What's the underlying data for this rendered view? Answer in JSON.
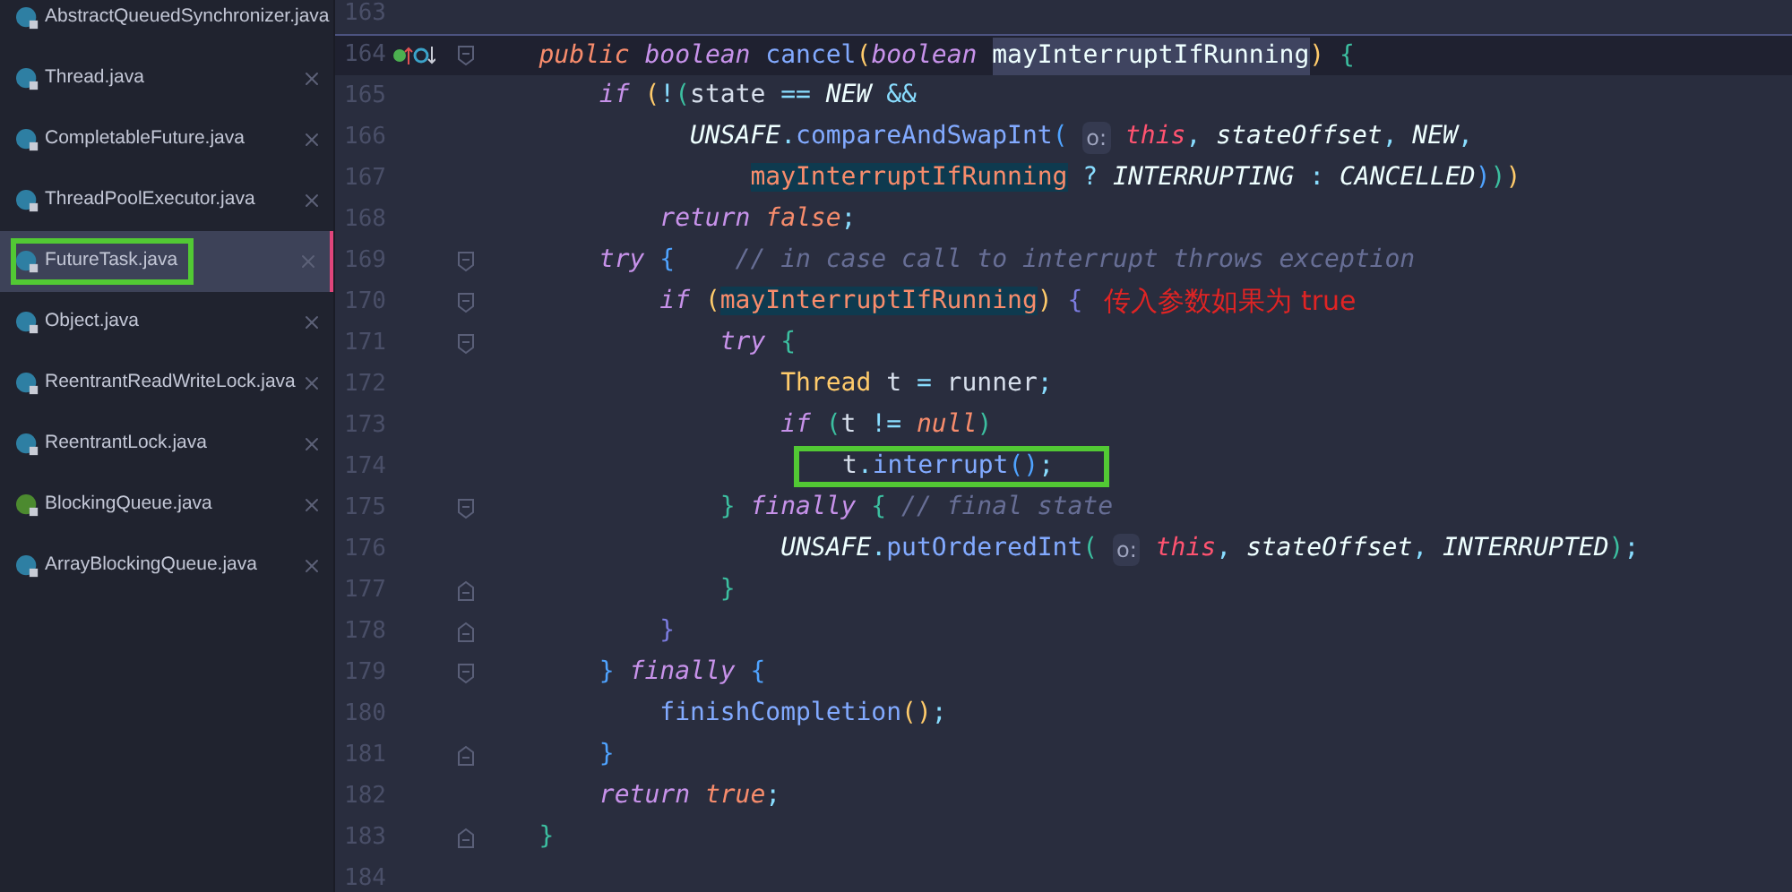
{
  "sidebar": {
    "items": [
      {
        "label": "AbstractQueuedSynchronizer.java",
        "kind": "class",
        "selected": false,
        "boxed": false,
        "closable": false
      },
      {
        "label": "Thread.java",
        "kind": "class",
        "selected": false,
        "boxed": false,
        "closable": true
      },
      {
        "label": "CompletableFuture.java",
        "kind": "class",
        "selected": false,
        "boxed": false,
        "closable": true
      },
      {
        "label": "ThreadPoolExecutor.java",
        "kind": "class",
        "selected": false,
        "boxed": false,
        "closable": true
      },
      {
        "label": "FutureTask.java",
        "kind": "class",
        "selected": true,
        "boxed": true,
        "closable": true
      },
      {
        "label": "Object.java",
        "kind": "class",
        "selected": false,
        "boxed": false,
        "closable": true
      },
      {
        "label": "ReentrantReadWriteLock.java",
        "kind": "class",
        "selected": false,
        "boxed": false,
        "closable": true
      },
      {
        "label": "ReentrantLock.java",
        "kind": "class",
        "selected": false,
        "boxed": false,
        "closable": true
      },
      {
        "label": "BlockingQueue.java",
        "kind": "interface",
        "selected": false,
        "boxed": false,
        "closable": true
      },
      {
        "label": "ArrayBlockingQueue.java",
        "kind": "class",
        "selected": false,
        "boxed": false,
        "closable": true
      }
    ]
  },
  "editor": {
    "lines": [
      {
        "number": "163",
        "kind": "plain",
        "current": false
      },
      {
        "number": "164",
        "kind": "fold_open",
        "current": true,
        "boxed": false,
        "gutter_icons": true,
        "tokens": [
          {
            "kind": "kw2",
            "text": "    public"
          },
          {
            "kind": "kw",
            "text": " boolean"
          },
          {
            "kind": "fn",
            "text": " cancel"
          },
          {
            "kind": "p1",
            "text": "("
          },
          {
            "kind": "kw",
            "text": "boolean "
          },
          {
            "kind": "sel",
            "text": "mayInterruptIfRunning"
          },
          {
            "kind": "p1",
            "text": ")"
          },
          {
            "kind": "p3",
            "text": " {"
          }
        ]
      },
      {
        "number": "165",
        "kind": "plain",
        "current": false,
        "boxed": false,
        "tokens": [
          {
            "kind": "kw",
            "text": "        if"
          },
          {
            "kind": "p1",
            "text": " ("
          },
          {
            "kind": "op",
            "text": "!"
          },
          {
            "kind": "p3",
            "text": "("
          },
          {
            "kind": "plain",
            "text": "state"
          },
          {
            "kind": "op",
            "text": " =="
          },
          {
            "kind": "const",
            "text": " NEW"
          },
          {
            "kind": "op",
            "text": " &&"
          }
        ]
      },
      {
        "number": "166",
        "kind": "plain",
        "current": false,
        "boxed": false,
        "tokens": [
          {
            "kind": "const",
            "text": "              UNSAFE"
          },
          {
            "kind": "op",
            "text": "."
          },
          {
            "kind": "fn",
            "text": "compareAndSwapInt"
          },
          {
            "kind": "p2",
            "text": "( "
          },
          {
            "kind": "hint",
            "text": "o:"
          },
          {
            "kind": "this",
            "text": " this"
          },
          {
            "kind": "op",
            "text": ","
          },
          {
            "kind": "ital",
            "text": " stateOffset"
          },
          {
            "kind": "op",
            "text": ","
          },
          {
            "kind": "const",
            "text": " NEW"
          },
          {
            "kind": "op",
            "text": ","
          }
        ]
      },
      {
        "number": "167",
        "kind": "plain",
        "current": false,
        "boxed": false,
        "tokens": [
          {
            "kind": "hl",
            "text": "                  mayInterruptIfRunning"
          },
          {
            "kind": "op",
            "text": " ?"
          },
          {
            "kind": "const",
            "text": " INTERRUPTING"
          },
          {
            "kind": "op",
            "text": " :"
          },
          {
            "kind": "const",
            "text": " CANCELLED"
          },
          {
            "kind": "p2",
            "text": ")"
          },
          {
            "kind": "p3",
            "text": ")"
          },
          {
            "kind": "p1",
            "text": ")"
          }
        ]
      },
      {
        "number": "168",
        "kind": "plain",
        "current": false,
        "boxed": false,
        "tokens": [
          {
            "kind": "kw",
            "text": "            return"
          },
          {
            "kind": "lit",
            "text": " false"
          },
          {
            "kind": "op",
            "text": ";"
          }
        ]
      },
      {
        "number": "169",
        "kind": "fold_open",
        "current": false,
        "boxed": false,
        "tokens": [
          {
            "kind": "kw",
            "text": "        try"
          },
          {
            "kind": "p2",
            "text": " {"
          },
          {
            "kind": "comment",
            "text": "    // in case call to interrupt throws exception"
          }
        ]
      },
      {
        "number": "170",
        "kind": "fold_open",
        "current": false,
        "boxed": false,
        "annotation": "传入参数如果为 true",
        "tokens": [
          {
            "kind": "kw",
            "text": "            if"
          },
          {
            "kind": "p1",
            "text": " ("
          },
          {
            "kind": "hl",
            "text": "mayInterruptIfRunning"
          },
          {
            "kind": "p1",
            "text": ")"
          },
          {
            "kind": "p4",
            "text": " {"
          }
        ]
      },
      {
        "number": "171",
        "kind": "fold_open",
        "current": false,
        "boxed": false,
        "tokens": [
          {
            "kind": "kw",
            "text": "                try"
          },
          {
            "kind": "p3",
            "text": " {"
          }
        ]
      },
      {
        "number": "172",
        "kind": "plain",
        "current": false,
        "boxed": false,
        "tokens": [
          {
            "kind": "type",
            "text": "                    Thread"
          },
          {
            "kind": "plain",
            "text": " t"
          },
          {
            "kind": "op",
            "text": " ="
          },
          {
            "kind": "plain",
            "text": " runner"
          },
          {
            "kind": "op",
            "text": ";"
          }
        ]
      },
      {
        "number": "173",
        "kind": "plain",
        "current": false,
        "boxed": false,
        "tokens": [
          {
            "kind": "kw",
            "text": "                    if"
          },
          {
            "kind": "p3",
            "text": " ("
          },
          {
            "kind": "plain",
            "text": "t"
          },
          {
            "kind": "op",
            "text": " !="
          },
          {
            "kind": "lit",
            "text": " null"
          },
          {
            "kind": "p3",
            "text": ")"
          }
        ]
      },
      {
        "number": "174",
        "kind": "plain",
        "current": false,
        "boxed": true,
        "tokens": [
          {
            "kind": "plain",
            "text": "t"
          },
          {
            "kind": "op",
            "text": "."
          },
          {
            "kind": "fn",
            "text": "interrupt"
          },
          {
            "kind": "p2",
            "text": "()"
          },
          {
            "kind": "op",
            "text": ";"
          }
        ]
      },
      {
        "number": "175",
        "kind": "fold_open",
        "current": false,
        "boxed": false,
        "tokens": [
          {
            "kind": "p3",
            "text": "                }"
          },
          {
            "kind": "kw",
            "text": " finally"
          },
          {
            "kind": "p3",
            "text": " {"
          },
          {
            "kind": "comment",
            "text": " // final state"
          }
        ]
      },
      {
        "number": "176",
        "kind": "plain",
        "current": false,
        "boxed": false,
        "tokens": [
          {
            "kind": "const",
            "text": "                    UNSAFE"
          },
          {
            "kind": "op",
            "text": "."
          },
          {
            "kind": "fn",
            "text": "putOrderedInt"
          },
          {
            "kind": "p3",
            "text": "( "
          },
          {
            "kind": "hint",
            "text": "o:"
          },
          {
            "kind": "this",
            "text": " this"
          },
          {
            "kind": "op",
            "text": ","
          },
          {
            "kind": "ital",
            "text": " stateOffset"
          },
          {
            "kind": "op",
            "text": ","
          },
          {
            "kind": "const",
            "text": " INTERRUPTED"
          },
          {
            "kind": "p3",
            "text": ")"
          },
          {
            "kind": "op",
            "text": ";"
          }
        ]
      },
      {
        "number": "177",
        "kind": "fold_close",
        "current": false,
        "boxed": false,
        "tokens": [
          {
            "kind": "p3",
            "text": "                }"
          }
        ]
      },
      {
        "number": "178",
        "kind": "fold_close",
        "current": false,
        "boxed": false,
        "tokens": [
          {
            "kind": "p4",
            "text": "            }"
          }
        ]
      },
      {
        "number": "179",
        "kind": "fold_open",
        "current": false,
        "boxed": false,
        "tokens": [
          {
            "kind": "p2",
            "text": "        }"
          },
          {
            "kind": "kw",
            "text": " finally"
          },
          {
            "kind": "p2",
            "text": " {"
          }
        ]
      },
      {
        "number": "180",
        "kind": "plain",
        "current": false,
        "boxed": false,
        "tokens": [
          {
            "kind": "fn",
            "text": "            finishCompletion"
          },
          {
            "kind": "p1",
            "text": "()"
          },
          {
            "kind": "op",
            "text": ";"
          }
        ]
      },
      {
        "number": "181",
        "kind": "fold_close",
        "current": false,
        "boxed": false,
        "tokens": [
          {
            "kind": "p2",
            "text": "        }"
          }
        ]
      },
      {
        "number": "182",
        "kind": "plain",
        "current": false,
        "boxed": false,
        "tokens": [
          {
            "kind": "kw",
            "text": "        return"
          },
          {
            "kind": "lit",
            "text": " true"
          },
          {
            "kind": "op",
            "text": ";"
          }
        ]
      },
      {
        "number": "183",
        "kind": "fold_close",
        "current": false,
        "boxed": false,
        "tokens": [
          {
            "kind": "p3",
            "text": "    }"
          }
        ]
      },
      {
        "number": "184",
        "kind": "plain",
        "current": false
      }
    ]
  }
}
